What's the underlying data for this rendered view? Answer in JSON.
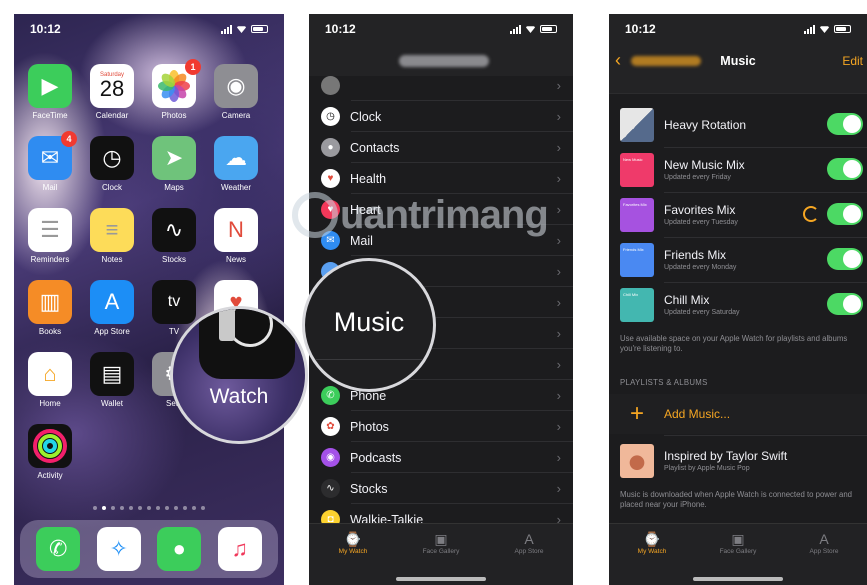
{
  "status": {
    "time": "10:12"
  },
  "home": {
    "rows": [
      [
        {
          "label": "FaceTime",
          "icon": "video-icon",
          "color": "#3ccd5b",
          "glyph": "▶"
        },
        {
          "label": "Calendar",
          "icon": "calendar-icon",
          "color": "#ffffff",
          "cal_day": "Saturday",
          "cal_date": "28"
        },
        {
          "label": "Photos",
          "icon": "photos-icon",
          "color": "#ffffff",
          "badge": "1"
        },
        {
          "label": "Camera",
          "icon": "camera-icon",
          "color": "#8e8e93",
          "glyph": "◉"
        }
      ],
      [
        {
          "label": "Mail",
          "icon": "mail-icon",
          "color": "#2f8cf1",
          "glyph": "✉",
          "badge": "4"
        },
        {
          "label": "Clock",
          "icon": "clock-icon",
          "color": "#111111",
          "glyph": "◷"
        },
        {
          "label": "Maps",
          "icon": "maps-icon",
          "color": "#6fc37b",
          "glyph": "➤"
        },
        {
          "label": "Weather",
          "icon": "weather-icon",
          "color": "#4aa6f0",
          "glyph": "☁"
        }
      ],
      [
        {
          "label": "Reminders",
          "icon": "reminders-icon",
          "color": "#ffffff",
          "glyph": "☰"
        },
        {
          "label": "Notes",
          "icon": "notes-icon",
          "color": "#fddc59",
          "glyph": "≡"
        },
        {
          "label": "Stocks",
          "icon": "stocks-icon",
          "color": "#111111",
          "glyph": "∿"
        },
        {
          "label": "News",
          "icon": "news-icon",
          "color": "#ffffff",
          "glyph": "N"
        }
      ],
      [
        {
          "label": "Books",
          "icon": "books-icon",
          "color": "#f58c26",
          "glyph": "▥"
        },
        {
          "label": "App Store",
          "icon": "app-store-icon",
          "color": "#1c8ef6",
          "glyph": "A"
        },
        {
          "label": "TV",
          "icon": "tv-icon",
          "color": "#111111",
          "glyph": "tv"
        },
        {
          "label": "",
          "icon": "health-icon",
          "color": "#ffffff",
          "glyph": "♥"
        }
      ],
      [
        {
          "label": "Home",
          "icon": "home-icon",
          "color": "#ffffff",
          "glyph": "⌂"
        },
        {
          "label": "Wallet",
          "icon": "wallet-icon",
          "color": "#111111",
          "glyph": "▤"
        },
        {
          "label": "Setti",
          "icon": "settings-icon",
          "color": "#8e8e93",
          "glyph": "⚙"
        },
        null
      ],
      [
        {
          "label": "Activity",
          "icon": "activity-icon",
          "color": "#111111",
          "glyph": "◎"
        },
        null,
        null,
        null
      ]
    ],
    "dock": [
      {
        "icon": "phone-icon",
        "color": "#3ccd5b",
        "glyph": "✆"
      },
      {
        "icon": "safari-icon",
        "color": "#ffffff",
        "glyph": "✧"
      },
      {
        "icon": "messages-icon",
        "color": "#3ccd5b",
        "glyph": "●"
      },
      {
        "icon": "music-icon",
        "color": "#ffffff",
        "glyph": "♫"
      }
    ],
    "zoom_label": "Watch"
  },
  "watch_settings": {
    "rows": [
      {
        "label": "",
        "icon": "app-icon",
        "color": "#777777",
        "glyph": ""
      },
      {
        "label": "Clock",
        "icon": "clock-icon",
        "color": "#ffffff",
        "glyph": "◷"
      },
      {
        "label": "Contacts",
        "icon": "contacts-icon",
        "color": "#9a9a9f",
        "glyph": "●"
      },
      {
        "label": "Health",
        "icon": "health-icon",
        "color": "#ffffff",
        "glyph": "♥"
      },
      {
        "label": "Heart",
        "icon": "heart-icon",
        "color": "#f2385a",
        "glyph": "♥"
      },
      {
        "label": "Mail",
        "icon": "mail-icon",
        "color": "#2f8cf1",
        "glyph": "✉"
      },
      {
        "label": "",
        "icon": "maps-icon",
        "color": "#5a9ff0",
        "glyph": ""
      },
      {
        "label": "",
        "icon": "messages-icon",
        "color": "#444444",
        "glyph": ""
      },
      {
        "label": "",
        "icon": "music-icon",
        "color": "#444444",
        "glyph": ""
      },
      {
        "label": "",
        "icon": "news-icon",
        "color": "#444444",
        "glyph": ""
      },
      {
        "label": "Phone",
        "icon": "phone-icon",
        "color": "#3ccd5b",
        "glyph": "✆"
      },
      {
        "label": "Photos",
        "icon": "photos-icon",
        "color": "#ffffff",
        "glyph": "✿"
      },
      {
        "label": "Podcasts",
        "icon": "podcasts-icon",
        "color": "#a451e8",
        "glyph": "◉"
      },
      {
        "label": "Stocks",
        "icon": "stocks-icon",
        "color": "#2c2c2e",
        "glyph": "∿"
      },
      {
        "label": "Walkie-Talkie",
        "icon": "walkie-talkie-icon",
        "color": "#fcd22f",
        "glyph": "◘"
      }
    ],
    "zoom_label": "Music",
    "tabs": [
      {
        "label": "My Watch",
        "icon": "watch-icon",
        "glyph": "⌚"
      },
      {
        "label": "Face Gallery",
        "icon": "face-gallery-icon",
        "glyph": "▣"
      },
      {
        "label": "App Store",
        "icon": "app-store-icon",
        "glyph": "A"
      }
    ]
  },
  "music": {
    "title": "Music",
    "edit_label": "Edit",
    "playlists": [
      {
        "name": "Heavy Rotation",
        "sub": "",
        "art": "#5b6b8f",
        "art_text": ""
      },
      {
        "name": "New Music Mix",
        "sub": "Updated every Friday",
        "art": "#ef3a6a",
        "art_text": "New Music"
      },
      {
        "name": "Favorites Mix",
        "sub": "Updated every Tuesday",
        "art": "#a652e0",
        "art_text": "Favorites Mix",
        "syncing": true
      },
      {
        "name": "Friends Mix",
        "sub": "Updated every Monday",
        "art": "#4a89f2",
        "art_text": "Friends Mix"
      },
      {
        "name": "Chill Mix",
        "sub": "Updated every Saturday",
        "art": "#43b7b0",
        "art_text": "Chill Mix"
      }
    ],
    "space_note": "Use available space on your Apple Watch for playlists and albums you're listening to.",
    "section_header": "PLAYLISTS & ALBUMS",
    "add_label": "Add Music...",
    "album": {
      "name": "Inspired by Taylor Swift",
      "sub": "Playlist by Apple Music Pop",
      "art": "#f0b89a"
    },
    "download_note": "Music is downloaded when Apple Watch is connected to power and placed near your iPhone.",
    "tabs": [
      {
        "label": "My Watch",
        "icon": "watch-icon",
        "glyph": "⌚"
      },
      {
        "label": "Face Gallery",
        "icon": "face-gallery-icon",
        "glyph": "▣"
      },
      {
        "label": "App Store",
        "icon": "app-store-icon",
        "glyph": "A"
      }
    ]
  },
  "watermark": {
    "text": "uantrimang"
  },
  "colors": {
    "accent": "#f5a623",
    "toggle_on": "#4cd964",
    "dark_bg": "#1c1c1e"
  }
}
